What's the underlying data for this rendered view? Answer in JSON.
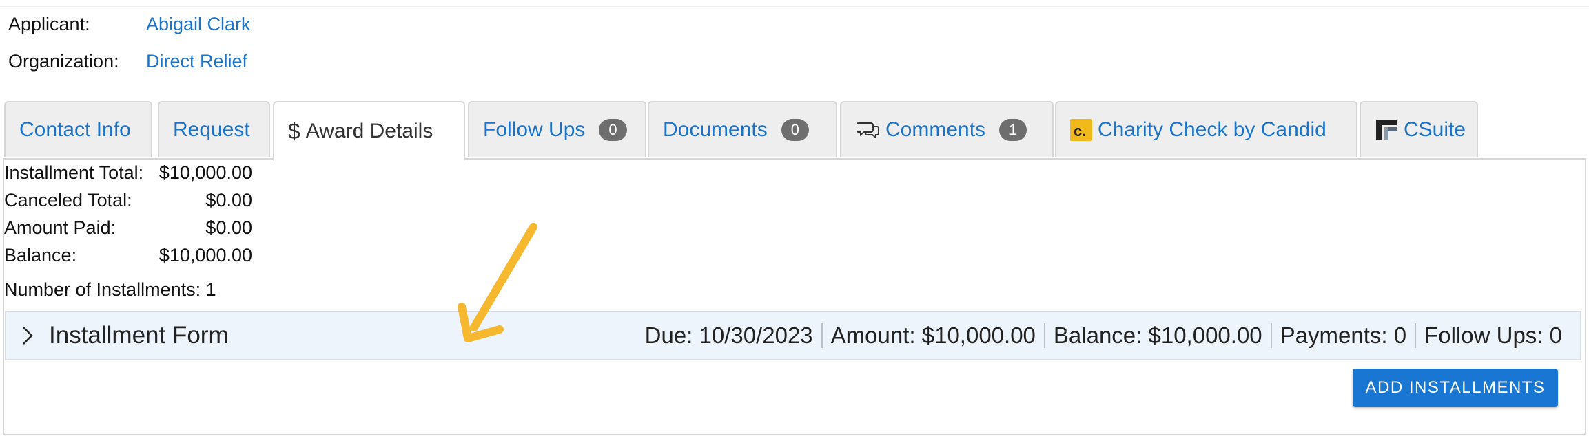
{
  "header": {
    "applicant_label": "Applicant:",
    "applicant_value": "Abigail Clark",
    "organization_label": "Organization:",
    "organization_value": "Direct Relief"
  },
  "tabs": [
    {
      "label": "Contact Info"
    },
    {
      "label": "Request"
    },
    {
      "label": "Award Details",
      "icon": "dollar-icon",
      "active": true
    },
    {
      "label": "Follow Ups",
      "badge": "0"
    },
    {
      "label": "Documents",
      "badge": "0"
    },
    {
      "label": "Comments",
      "icon": "comments-icon",
      "badge": "1"
    },
    {
      "label": "Charity Check by Candid",
      "icon": "candid-logo-icon"
    },
    {
      "label": "CSuite",
      "icon": "csuite-logo-icon"
    }
  ],
  "summary": {
    "installment_total_label": "Installment Total:",
    "installment_total_value": "$10,000.00",
    "canceled_total_label": "Canceled Total:",
    "canceled_total_value": "$0.00",
    "amount_paid_label": "Amount Paid:",
    "amount_paid_value": "$0.00",
    "balance_label": "Balance:",
    "balance_value": "$10,000.00",
    "number_of_installments": "Number of Installments: 1"
  },
  "installment": {
    "title": "Installment Form",
    "due": "Due: 10/30/2023",
    "amount": "Amount: $10,000.00",
    "balance": "Balance: $10,000.00",
    "payments": "Payments: 0",
    "follow_ups": "Follow Ups: 0"
  },
  "actions": {
    "add_installments_label": "ADD INSTALLMENTS"
  },
  "colors": {
    "link": "#1a73c9",
    "button": "#1976d2",
    "annotation_arrow": "#f5b82e",
    "row_background": "#eef4fb"
  }
}
